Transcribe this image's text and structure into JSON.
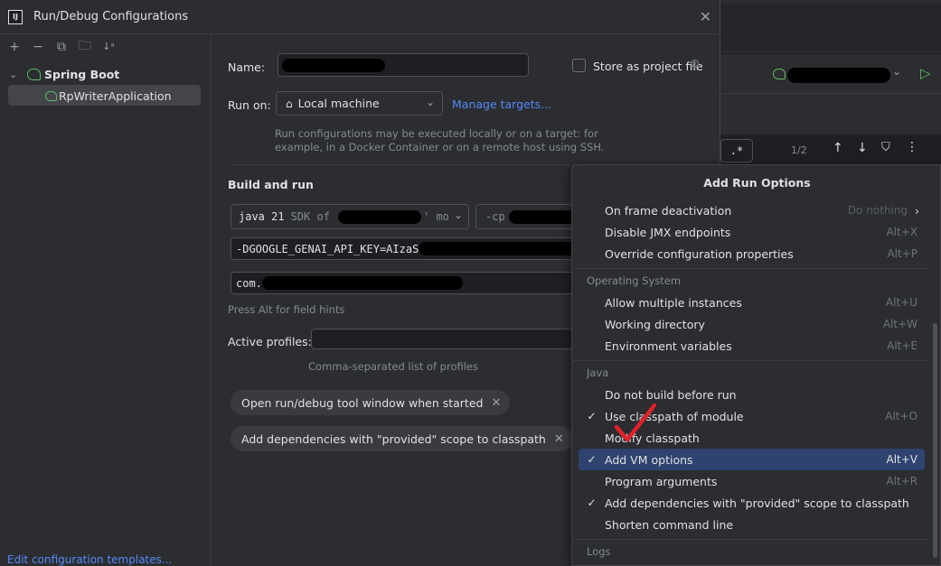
{
  "dialog": {
    "title": "Run/Debug Configurations",
    "app_icon_text": "IJ"
  },
  "sidebar": {
    "group_label": "Spring Boot",
    "item_label": "RpWriterApplication",
    "edit_templates_link": "Edit configuration templates..."
  },
  "form": {
    "name_label": "Name:",
    "name_underline_char": "N",
    "store_as_project_file": "Store as project file",
    "run_on_label": "Run on:",
    "run_on_value": "Local machine",
    "manage_targets_link": "Manage targets...",
    "run_on_hint_line1": "Run configurations may be executed locally or on a target: for",
    "run_on_hint_line2": "example, in a Docker Container or on a remote host using SSH.",
    "build_and_run_title": "Build and run",
    "jdk_select_prefix": "java 21",
    "jdk_select_suffix": "SDK of",
    "jdk_select_tail": "' mo",
    "classpath_prefix": "-cp",
    "vm_options_value": "-DGOOGLE_GENAI_API_KEY=AIzaS",
    "main_class_value": "com.",
    "alt_hint": "Press Alt for field hints",
    "active_profiles_label": "Active profiles:",
    "active_profiles_hint": "Comma-separated list of profiles",
    "chip1": "Open run/debug tool window when started",
    "chip2": "Add dependencies with \"provided\" scope to classpath"
  },
  "ide": {
    "search_regex_btn": ".*",
    "match_count": "1/2"
  },
  "popup": {
    "title": "Add Run Options",
    "items_top": [
      {
        "label": "On frame deactivation",
        "value": "Do nothing",
        "arrow": "›"
      },
      {
        "label": "Disable JMX endpoints",
        "shortcut": "Alt+X"
      },
      {
        "label": "Override configuration properties",
        "shortcut": "Alt+P"
      }
    ],
    "section_os": "Operating System",
    "items_os": [
      {
        "label": "Allow multiple instances",
        "shortcut": "Alt+U"
      },
      {
        "label": "Working directory",
        "shortcut": "Alt+W"
      },
      {
        "label": "Environment variables",
        "shortcut": "Alt+E"
      }
    ],
    "section_java": "Java",
    "items_java": [
      {
        "label": "Do not build before run",
        "shortcut": "",
        "checked": false
      },
      {
        "label": "Use classpath of module",
        "shortcut": "Alt+O",
        "checked": true
      },
      {
        "label": "Modify classpath",
        "shortcut": "",
        "checked": false
      },
      {
        "label": "Add VM options",
        "shortcut": "Alt+V",
        "checked": true,
        "selected": true
      },
      {
        "label": "Program arguments",
        "shortcut": "Alt+R",
        "checked": false
      },
      {
        "label": "Add dependencies with \"provided\" scope to classpath",
        "shortcut": "",
        "checked": true
      },
      {
        "label": "Shorten command line",
        "shortcut": "",
        "checked": false
      }
    ],
    "section_logs": "Logs",
    "check_glyph": "✓"
  },
  "colors": {
    "accent_link": "#548af7",
    "selection": "#2e436e",
    "run_green": "#5fb865",
    "annotation_red": "#e0202a"
  }
}
